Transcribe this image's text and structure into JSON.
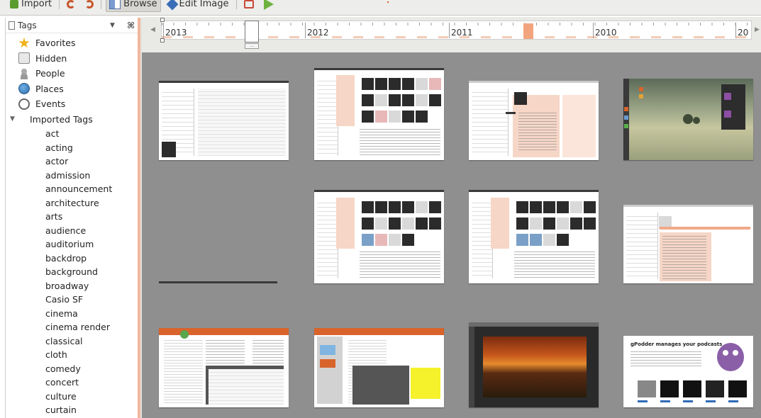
{
  "toolbar": {
    "import_label": "Import",
    "browse_label": "Browse",
    "edit_label": "Edit Image"
  },
  "sidebar": {
    "title": "Tags",
    "items": [
      {
        "label": "Favorites",
        "icon": "star-icon"
      },
      {
        "label": "Hidden",
        "icon": "hidden-icon"
      },
      {
        "label": "People",
        "icon": "people-icon"
      },
      {
        "label": "Places",
        "icon": "globe-icon"
      },
      {
        "label": "Events",
        "icon": "clock-icon"
      }
    ],
    "imported_label": "Imported Tags",
    "tags": [
      "act",
      "acting",
      "actor",
      "admission",
      "announcement",
      "architecture",
      "arts",
      "audience",
      "auditorium",
      "backdrop",
      "background",
      "broadway",
      "Casio SF",
      "cinema",
      "cinema render",
      "classical",
      "cloth",
      "comedy",
      "concert",
      "culture",
      "curtain"
    ]
  },
  "timeline": {
    "years": [
      "2013",
      "2012",
      "2011",
      "2010",
      "20"
    ]
  },
  "thumbnails": {
    "gpodder_title": "gPodder manages your podcasts"
  },
  "colors": {
    "accent": "#f2a47e",
    "grid_background": "#8f8f8f",
    "toolbar_bg": "#ededeb"
  }
}
